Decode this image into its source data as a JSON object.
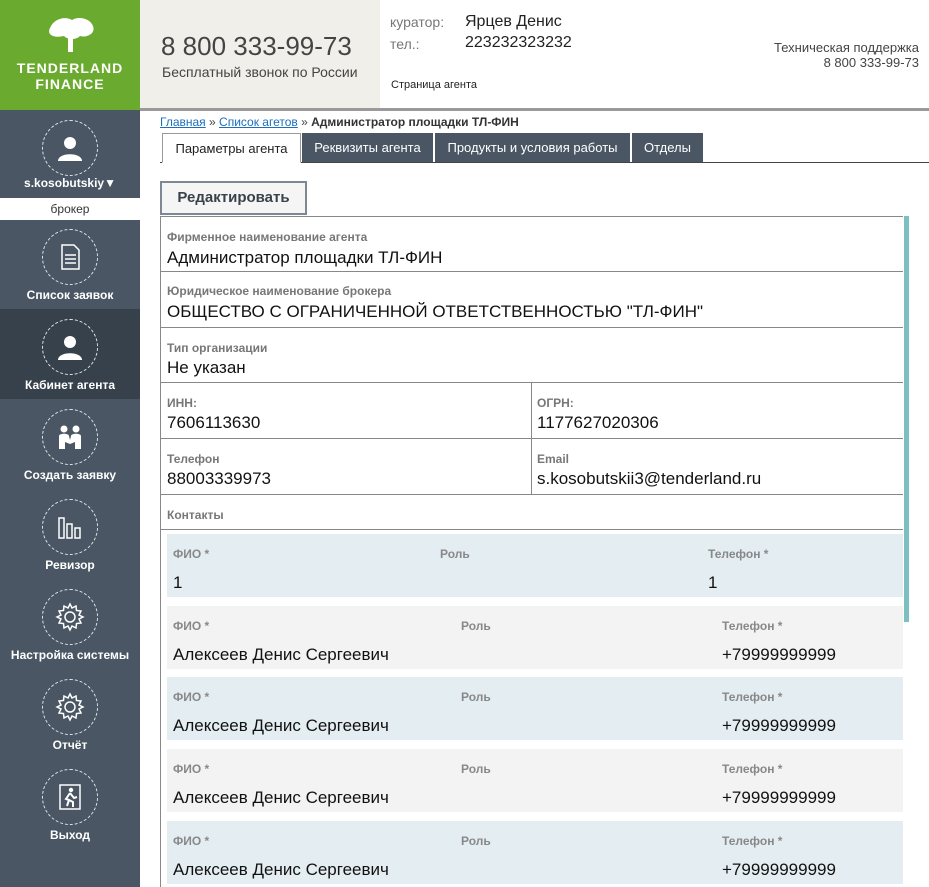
{
  "logo": {
    "line1": "TENDERLAND",
    "line2": "FINANCE",
    "color": "#6aaa2e"
  },
  "user": {
    "name": "s.kosobutskiy▼",
    "role": "брокер"
  },
  "nav": [
    {
      "label": "Список заявок",
      "icon": "document-icon"
    },
    {
      "label": "Кабинет агента",
      "icon": "user-icon",
      "active": true
    },
    {
      "label": "Создать заявку",
      "icon": "handshake-icon"
    },
    {
      "label": "Ревизор",
      "icon": "bar-chart-icon"
    },
    {
      "label": "Настройка системы",
      "icon": "gear-icon"
    },
    {
      "label": "Отчёт",
      "icon": "gear-icon"
    },
    {
      "label": "Выход",
      "icon": "exit-icon"
    }
  ],
  "header": {
    "phone": "8 800 333-99-73",
    "phone_sub": "Бесплатный звонок по России",
    "curator_label": "куратор:",
    "curator_value": "Ярцев Денис",
    "tel_label": "тел.:",
    "tel_value": "223232323232",
    "page_name": "Страница агента",
    "support_title": "Техническая поддержка",
    "support_phone": "8 800 333-99-73"
  },
  "breadcrumb": {
    "home": "Главная",
    "sep": " » ",
    "list": "Список агетов",
    "current": "Администратор площадки ТЛ-ФИН"
  },
  "tabs": [
    "Параметры агента",
    "Реквизиты агента",
    "Продукты и условия работы",
    "Отделы"
  ],
  "edit_label": "Редактировать",
  "fields": {
    "brand_label": "Фирменное наименование агента",
    "brand_value": "Администратор площадки ТЛ-ФИН",
    "legal_label": "Юридическое наименование брокера",
    "legal_value": "ОБЩЕСТВО С ОГРАНИЧЕННОЙ ОТВЕТСТВЕННОСТЬЮ \"ТЛ-ФИН\"",
    "orgtype_label": "Тип организации",
    "orgtype_value": "Не указан",
    "inn_label": "ИНН:",
    "inn_value": "7606113630",
    "ogrn_label": "ОГРН:",
    "ogrn_value": "1177627020306",
    "phone_label": "Телефон",
    "phone_value": "88003339973",
    "email_label": "Email",
    "email_value": "s.kosobutskii3@tenderland.ru",
    "contacts_label": "Контакты"
  },
  "contact_headers": {
    "fio": "ФИО *",
    "role": "Роль",
    "phone": "Телефон *"
  },
  "contacts": [
    {
      "fio": "1",
      "role": "",
      "phone": "1"
    },
    {
      "fio": "Алексеев Денис Сергеевич",
      "role": "",
      "phone": "+79999999999"
    },
    {
      "fio": "Алексеев Денис Сергеевич",
      "role": "",
      "phone": "+79999999999"
    },
    {
      "fio": "Алексеев Денис Сергеевич",
      "role": "",
      "phone": "+79999999999"
    },
    {
      "fio": "Алексеев Денис Сергеевич",
      "role": "",
      "phone": "+79999999999"
    }
  ]
}
